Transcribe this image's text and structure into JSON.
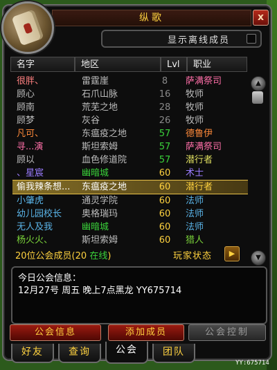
{
  "window": {
    "title": "纵歌",
    "close_label": "x"
  },
  "offline_toggle": {
    "label": "显示离线成员"
  },
  "columns": {
    "name": "名字",
    "zone": "地区",
    "level": "Lvl",
    "class": "职业"
  },
  "roster": [
    {
      "name": "很胖、",
      "zone": "雷霆崖",
      "level": "8",
      "class": "萨满祭司",
      "name_color": "#ff8080",
      "zone_color": "#bdbdbd",
      "level_color": "#8a8a8a",
      "class_color": "#ff6fa8"
    },
    {
      "name": "顾心",
      "zone": "石爪山脉",
      "level": "16",
      "class": "牧师",
      "name_color": "#bdbdbd",
      "zone_color": "#bdbdbd",
      "level_color": "#8a8a8a",
      "class_color": "#bdbdbd"
    },
    {
      "name": "顾南",
      "zone": "荒芜之地",
      "level": "28",
      "class": "牧师",
      "name_color": "#bdbdbd",
      "zone_color": "#bdbdbd",
      "level_color": "#8a8a8a",
      "class_color": "#bdbdbd"
    },
    {
      "name": "顾梦",
      "zone": "灰谷",
      "level": "26",
      "class": "牧师",
      "name_color": "#bdbdbd",
      "zone_color": "#bdbdbd",
      "level_color": "#8a8a8a",
      "class_color": "#bdbdbd"
    },
    {
      "name": "凡可、",
      "zone": "东瘟疫之地",
      "level": "57",
      "class": "德鲁伊",
      "name_color": "#ff8a3a",
      "zone_color": "#bdbdbd",
      "level_color": "#3ad23a",
      "class_color": "#ff8a3a"
    },
    {
      "name": "寻...演",
      "zone": "斯坦索姆",
      "level": "57",
      "class": "萨满祭司",
      "name_color": "#ff6fa8",
      "zone_color": "#bdbdbd",
      "level_color": "#3ad23a",
      "class_color": "#ff6fa8"
    },
    {
      "name": "顾以",
      "zone": "血色修道院",
      "level": "57",
      "class": "潜行者",
      "name_color": "#bdbdbd",
      "zone_color": "#bdbdbd",
      "level_color": "#3ad23a",
      "class_color": "#e0e060"
    },
    {
      "name": "、星宸",
      "zone": "幽暗城",
      "level": "60",
      "class": "术士",
      "name_color": "#9a7cff",
      "zone_color": "#3ad23a",
      "level_color": "#ffd23f",
      "class_color": "#9a7cff"
    },
    {
      "name": "偷我辣条想...",
      "zone": "东瘟疫之地",
      "level": "60",
      "class": "潜行者",
      "name_color": "#ffffff",
      "zone_color": "#ffffff",
      "level_color": "#ffd23f",
      "class_color": "#ffd23f",
      "selected": true
    },
    {
      "name": "小肇虎",
      "zone": "通灵学院",
      "level": "60",
      "class": "法师",
      "name_color": "#5ab4e8",
      "zone_color": "#bdbdbd",
      "level_color": "#ffd23f",
      "class_color": "#5ab4e8"
    },
    {
      "name": "幼儿园校长",
      "zone": "奥格瑞玛",
      "level": "60",
      "class": "法师",
      "name_color": "#5ab4e8",
      "zone_color": "#bdbdbd",
      "level_color": "#ffd23f",
      "class_color": "#5ab4e8"
    },
    {
      "name": "无人及我",
      "zone": "幽暗城",
      "level": "60",
      "class": "法师",
      "name_color": "#5ab4e8",
      "zone_color": "#3ad23a",
      "level_color": "#ffd23f",
      "class_color": "#5ab4e8"
    },
    {
      "name": "杨火火、",
      "zone": "斯坦索姆",
      "level": "60",
      "class": "猎人",
      "name_color": "#7ad23a",
      "zone_color": "#bdbdbd",
      "level_color": "#ffd23f",
      "class_color": "#7ad23a"
    }
  ],
  "summary": {
    "count_text": "20位公会成员",
    "open_paren": "(",
    "online_count": "20",
    "online_label": "在线",
    "close_paren": ")"
  },
  "player_status": {
    "label": "玩家状态"
  },
  "motd": {
    "title": "今日公会信息：",
    "text": "12月27号 周五 晚上7点黑龙 YY675714"
  },
  "buttons": {
    "guild_info": "公会信息",
    "add_member": "添加成员",
    "guild_control": "公会控制"
  },
  "tabs": [
    {
      "label": "好友"
    },
    {
      "label": "查询"
    },
    {
      "label": "公会"
    },
    {
      "label": "团队"
    }
  ],
  "watermark": "YY:675714"
}
